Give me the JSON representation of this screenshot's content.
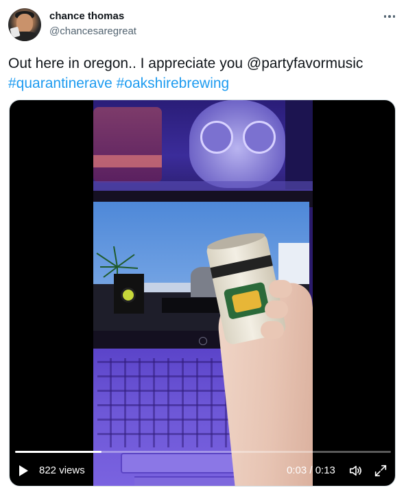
{
  "user": {
    "display_name": "chance thomas",
    "handle": "@chancesaregreat"
  },
  "tweet": {
    "text_plain": "Out here in oregon.. I appreciate you @partyfavormusic",
    "hashtag_1": "#quarantinerave",
    "hashtag_2": "#oakshirebrewing"
  },
  "video": {
    "views_label": "822 views",
    "time_label": "0:03 / 0:13",
    "progress_fraction": 0.23
  },
  "icons": {
    "more": "more-options-icon",
    "play": "play-icon",
    "volume": "volume-icon",
    "fullscreen": "fullscreen-icon"
  },
  "colors": {
    "link": "#1d9bf0",
    "text": "#0f1419",
    "secondary": "#536471"
  }
}
